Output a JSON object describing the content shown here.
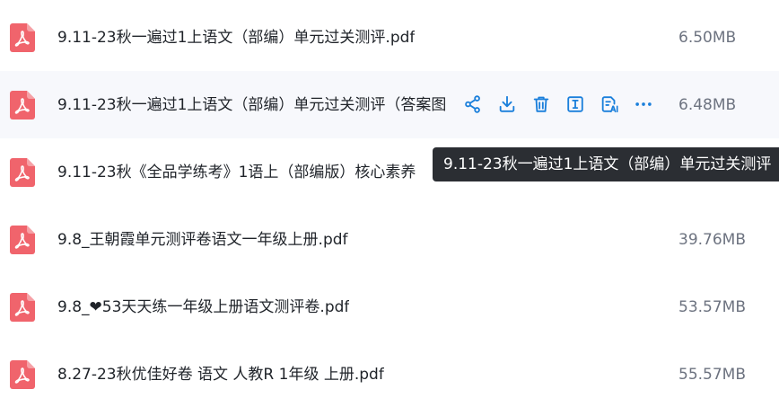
{
  "files": [
    {
      "name": "9.11-23秋一遍过1上语文（部编）单元过关测评.pdf",
      "size": "6.50MB"
    },
    {
      "name": "9.11-23秋一遍过1上语文（部编）单元过关测评（答案图",
      "size": "6.48MB"
    },
    {
      "name": "9.11-23秋《全品学练考》1语上（部编版）核心素养",
      "size": ""
    },
    {
      "name": "9.8_王朝霞单元测评卷语文一年级上册.pdf",
      "size": "39.76MB"
    },
    {
      "name": "9.8_❤53天天练一年级上册语文测评卷.pdf",
      "size": "53.57MB"
    },
    {
      "name": "8.27-23秋优佳好卷 语文 人教R 1年级 上册.pdf",
      "size": "55.57MB"
    }
  ],
  "tooltip": "9.11-23秋一遍过1上语文（部编）单元过关测评",
  "colors": {
    "pdf_icon": "#f0646c",
    "action_icon": "#1a7fdb",
    "hover_row": "#f7f8fc",
    "tooltip_bg": "#2b2e33"
  },
  "actions": [
    "share-icon",
    "download-icon",
    "delete-icon",
    "rename-icon",
    "ai-summary-icon",
    "more-icon"
  ]
}
